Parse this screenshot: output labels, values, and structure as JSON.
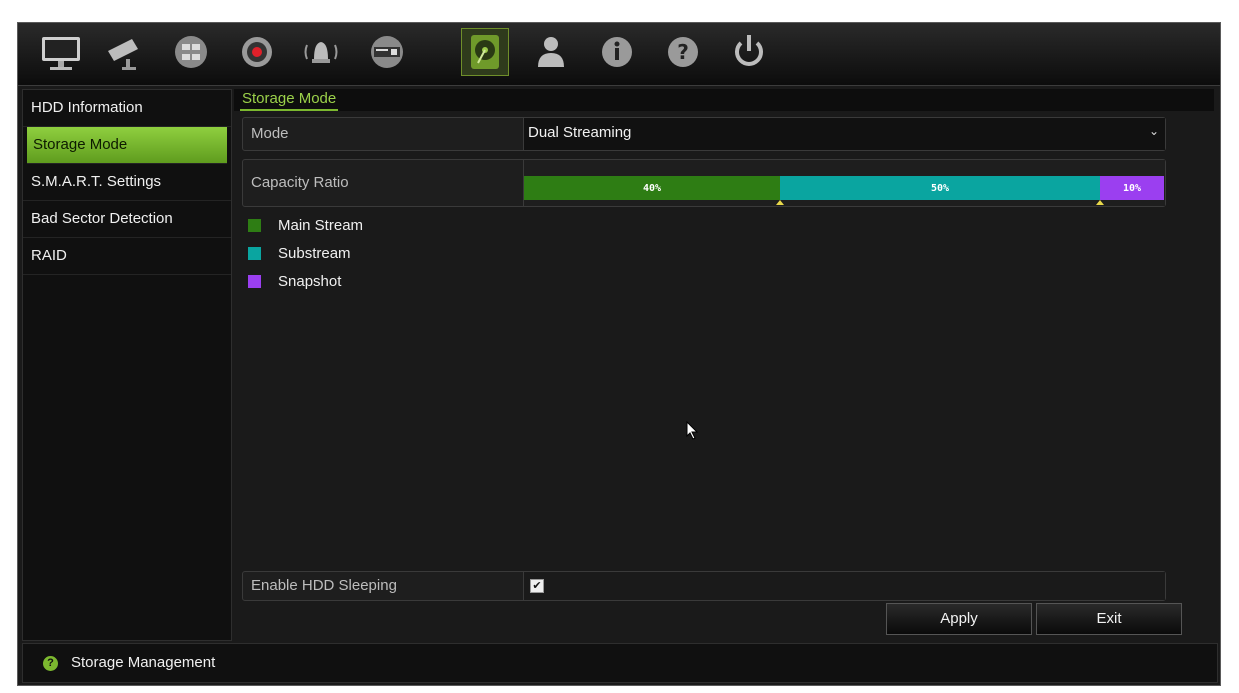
{
  "toolbar": {
    "icons": [
      "monitor-icon",
      "camera-icon",
      "network-icon",
      "record-icon",
      "alarm-icon",
      "device-icon",
      "hdd-icon",
      "user-icon",
      "info-icon",
      "help-icon",
      "power-icon"
    ],
    "active": "hdd-icon"
  },
  "sidebar": {
    "items": [
      {
        "label": "HDD Information"
      },
      {
        "label": "Storage Mode",
        "active": true
      },
      {
        "label": "S.M.A.R.T. Settings"
      },
      {
        "label": "Bad Sector Detection"
      },
      {
        "label": "RAID"
      }
    ]
  },
  "main": {
    "tab": "Storage Mode",
    "mode": {
      "label": "Mode",
      "value": "Dual Streaming"
    },
    "capacity": {
      "label": "Capacity Ratio",
      "segments": [
        {
          "text": "40%",
          "percent": 40,
          "color": "#2e7d14"
        },
        {
          "text": "50%",
          "percent": 50,
          "color": "#0aa5a0"
        },
        {
          "text": "10%",
          "percent": 10,
          "color": "#9b3ff0"
        }
      ]
    },
    "legend": [
      {
        "label": "Main Stream",
        "color": "#2e7d14"
      },
      {
        "label": "Substream",
        "color": "#0aa5a0"
      },
      {
        "label": "Snapshot",
        "color": "#9b3ff0"
      }
    ],
    "hdd_sleeping": {
      "label": "Enable HDD Sleeping",
      "checked": true
    },
    "apply_label": "Apply",
    "exit_label": "Exit"
  },
  "status": {
    "text": "Storage Management"
  },
  "colors": {
    "accent": "#7cb82f"
  }
}
